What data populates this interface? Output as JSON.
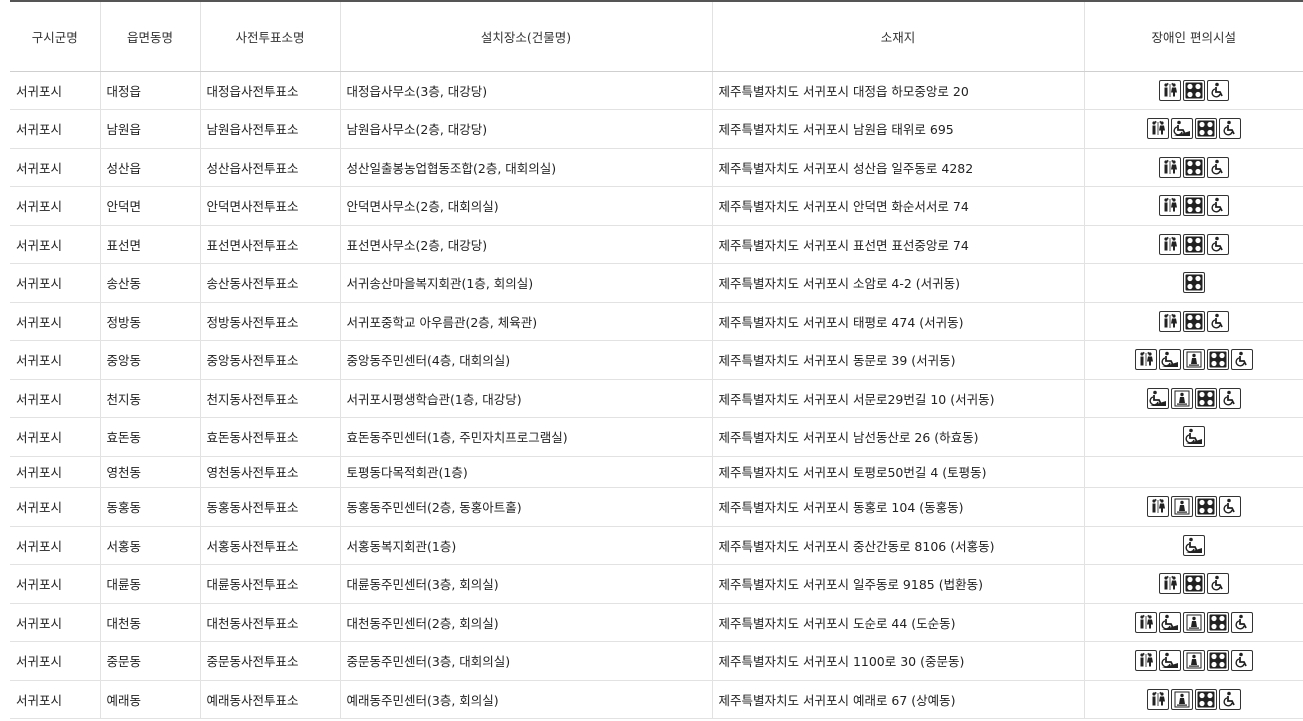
{
  "headers": [
    "구시군명",
    "읍면동명",
    "사전투표소명",
    "설치장소(건물명)",
    "소재지",
    "장애인 편의시설"
  ],
  "icon_legend": {
    "restroom": "restroom-icon",
    "ramp": "wheelchair-ramp-icon",
    "elevator": "elevator-icon",
    "braille": "braille-block-icon",
    "parking": "accessible-parking-icon"
  },
  "rows": [
    {
      "sigungu": "서귀포시",
      "dong": "대정읍",
      "station": "대정읍사전투표소",
      "place": "대정읍사무소(3층, 대강당)",
      "address": "제주특별자치도 서귀포시 대정읍 하모중앙로 20",
      "icons": [
        "restroom",
        "braille",
        "parking"
      ]
    },
    {
      "sigungu": "서귀포시",
      "dong": "남원읍",
      "station": "남원읍사전투표소",
      "place": "남원읍사무소(2층, 대강당)",
      "address": "제주특별자치도 서귀포시 남원읍 태위로 695",
      "icons": [
        "restroom",
        "ramp",
        "braille",
        "parking"
      ]
    },
    {
      "sigungu": "서귀포시",
      "dong": "성산읍",
      "station": "성산읍사전투표소",
      "place": "성산일출봉농업협동조합(2층, 대회의실)",
      "address": "제주특별자치도 서귀포시 성산읍 일주동로 4282",
      "icons": [
        "restroom",
        "braille",
        "parking"
      ]
    },
    {
      "sigungu": "서귀포시",
      "dong": "안덕면",
      "station": "안덕면사전투표소",
      "place": "안덕면사무소(2층, 대회의실)",
      "address": "제주특별자치도 서귀포시 안덕면 화순서서로 74",
      "icons": [
        "restroom",
        "braille",
        "parking"
      ]
    },
    {
      "sigungu": "서귀포시",
      "dong": "표선면",
      "station": "표선면사전투표소",
      "place": "표선면사무소(2층, 대강당)",
      "address": "제주특별자치도 서귀포시 표선면 표선중앙로 74",
      "icons": [
        "restroom",
        "braille",
        "parking"
      ]
    },
    {
      "sigungu": "서귀포시",
      "dong": "송산동",
      "station": "송산동사전투표소",
      "place": "서귀송산마을복지회관(1층, 회의실)",
      "address": "제주특별자치도 서귀포시 소암로 4-2 (서귀동)",
      "icons": [
        "braille"
      ]
    },
    {
      "sigungu": "서귀포시",
      "dong": "정방동",
      "station": "정방동사전투표소",
      "place": "서귀포중학교 아우름관(2층, 체육관)",
      "address": "제주특별자치도 서귀포시 태평로 474 (서귀동)",
      "icons": [
        "restroom",
        "braille",
        "parking"
      ]
    },
    {
      "sigungu": "서귀포시",
      "dong": "중앙동",
      "station": "중앙동사전투표소",
      "place": "중앙동주민센터(4층, 대회의실)",
      "address": "제주특별자치도 서귀포시 동문로 39 (서귀동)",
      "icons": [
        "restroom",
        "ramp",
        "elevator",
        "braille",
        "parking"
      ]
    },
    {
      "sigungu": "서귀포시",
      "dong": "천지동",
      "station": "천지동사전투표소",
      "place": "서귀포시평생학습관(1층, 대강당)",
      "address": "제주특별자치도 서귀포시 서문로29번길 10 (서귀동)",
      "icons": [
        "ramp",
        "elevator",
        "braille",
        "parking"
      ]
    },
    {
      "sigungu": "서귀포시",
      "dong": "효돈동",
      "station": "효돈동사전투표소",
      "place": "효돈동주민센터(1층, 주민자치프로그램실)",
      "address": "제주특별자치도 서귀포시 남선동산로 26 (하효동)",
      "icons": [
        "ramp"
      ]
    },
    {
      "sigungu": "서귀포시",
      "dong": "영천동",
      "station": "영천동사전투표소",
      "place": "토평동다목적회관(1층)",
      "address": "제주특별자치도 서귀포시 토평로50번길 4 (토평동)",
      "icons": []
    },
    {
      "sigungu": "서귀포시",
      "dong": "동홍동",
      "station": "동홍동사전투표소",
      "place": "동홍동주민센터(2층, 동홍아트홀)",
      "address": "제주특별자치도 서귀포시 동홍로 104 (동홍동)",
      "icons": [
        "restroom",
        "elevator",
        "braille",
        "parking"
      ]
    },
    {
      "sigungu": "서귀포시",
      "dong": "서홍동",
      "station": "서홍동사전투표소",
      "place": "서홍동복지회관(1층)",
      "address": "제주특별자치도 서귀포시 중산간동로 8106 (서홍동)",
      "icons": [
        "ramp"
      ]
    },
    {
      "sigungu": "서귀포시",
      "dong": "대륜동",
      "station": "대륜동사전투표소",
      "place": "대륜동주민센터(3층, 회의실)",
      "address": "제주특별자치도 서귀포시 일주동로 9185 (법환동)",
      "icons": [
        "restroom",
        "braille",
        "parking"
      ]
    },
    {
      "sigungu": "서귀포시",
      "dong": "대천동",
      "station": "대천동사전투표소",
      "place": "대천동주민센터(2층, 회의실)",
      "address": "제주특별자치도 서귀포시 도순로 44 (도순동)",
      "icons": [
        "restroom",
        "ramp",
        "elevator",
        "braille",
        "parking"
      ]
    },
    {
      "sigungu": "서귀포시",
      "dong": "중문동",
      "station": "중문동사전투표소",
      "place": "중문동주민센터(3층, 대회의실)",
      "address": "제주특별자치도 서귀포시 1100로 30 (중문동)",
      "icons": [
        "restroom",
        "ramp",
        "elevator",
        "braille",
        "parking"
      ]
    },
    {
      "sigungu": "서귀포시",
      "dong": "예래동",
      "station": "예래동사전투표소",
      "place": "예래동주민센터(3층, 회의실)",
      "address": "제주특별자치도 서귀포시 예래로 67 (상예동)",
      "icons": [
        "restroom",
        "elevator",
        "braille",
        "parking"
      ]
    }
  ]
}
